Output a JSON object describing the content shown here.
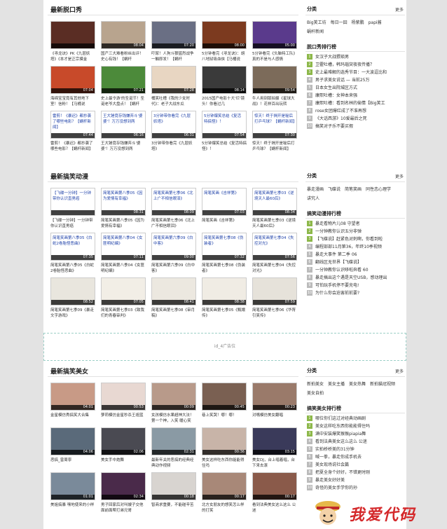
{
  "sections": [
    {
      "title": "最新脱口秀",
      "cards": [
        {
          "caption": "《寻龙诀》PK《九层妖塔》《本才是正宗摸金",
          "duration": "",
          "bg": "#5a2d24",
          "boxed": false
        },
        {
          "caption": "国产三大难看粉丝出评！史心有钱！【蜗杆",
          "duration": "08:04",
          "bg": "#b8a48e",
          "boxed": false
        },
        {
          "caption": "吓尿！人狗斗狠猛烈战争一触即发！【蜗杆",
          "duration": "07:20",
          "bg": "#6a6f84",
          "boxed": false
        },
        {
          "caption": "5分钟看完《寻龙诀》：胡八地狱吸血侠【马桶说",
          "duration": "08:00",
          "bg": "#7c3a1f",
          "boxed": false
        },
        {
          "caption": "5分钟看完《头脑特工队》真的不是与人感情",
          "duration": "05:00",
          "bg": "#5a3a8c",
          "boxed": false
        },
        {
          "caption": "海绵宝宝竟有其他地下室！信粉！【马桶说",
          "duration": "07:04",
          "bg": "#c84a2a",
          "boxed": false
        },
        {
          "caption": "史上最令游'的圣诞节！圣诞老爷大盘点！【蜗杆",
          "duration": "07:21",
          "bg": "#4c8a3a",
          "boxed": false
        },
        {
          "caption": "桶笑吐槽《我的少女时代》：老子大战东瓜",
          "duration": "07:28",
          "bg": "#e8d6c2",
          "boxed": false
        },
        {
          "caption": "2015国产电影十大'烂'镜头！你看过几",
          "duration": "08:14",
          "bg": "#3a3a3a",
          "boxed": false
        },
        {
          "caption": "牛人用刻版拍摄《星球大战》！花样百出玩转",
          "duration": "09:54",
          "bg": "#7c6b5a",
          "boxed": false
        },
        {
          "caption": "雷剪！《暴迟》都抄袭了哪些电影？【蜗杆新闻】",
          "duration": "07:44",
          "bg": "",
          "boxed": true
        },
        {
          "caption": "王大锤竟存钱嫌弃斗'婆婆'！万万没想到两",
          "duration": "06:16",
          "bg": "",
          "boxed": true
        },
        {
          "caption": "3分钟带你看完《九层妖塔》",
          "duration": "06:31",
          "bg": "",
          "boxed": true
        },
        {
          "caption": "5分钟爆笑总结《复活特搞怪》！",
          "duration": "07:54",
          "bg": "",
          "boxed": true
        },
        {
          "caption": "惊天！终于揭开是秘后打乒乓球？【蜗杆新闻】",
          "duration": "07:30",
          "bg": "",
          "boxed": true
        }
      ],
      "side_tags": [
        "Big笑工坊",
        "每日一囧",
        "杨紫鹏",
        "papi酱",
        "蜗杆新闻"
      ],
      "rank_title": "脱口秀排行榜",
      "rank": [
        "女汉子大战猥琐男",
        "卫霍吐槽，韩玛瑙突夜夜传播？",
        "史上最难解的选秀节目：一大波逗比和",
        "男子求美女说话 — 当前25万",
        "日本女生出院城区方式",
        "康熙吐槽：女神本来强",
        "康熙吐槽：看到名林的偷情【Big笑工",
        "rose女团爆红成了不准再想",
        "《大话西游》10爱最后之死",
        "搞笑对子乐不要买假"
      ]
    },
    {
      "title": "最新搞笑动漫",
      "cards": [
        {
          "caption": "【飞碟一分钟】一分钟带你认识直男癌",
          "duration": "",
          "bg": "",
          "boxed": true
        },
        {
          "caption": "简笔笑画第八季05《因为爱情有幸福》",
          "duration": "08:31",
          "bg": "",
          "boxed": true
        },
        {
          "caption": "简笔笑画第七季06《北上广不相信眼泪》",
          "duration": "08:09",
          "bg": "",
          "boxed": true
        },
        {
          "caption": "简笔笑画《吉祥第》",
          "duration": "07:03",
          "bg": "",
          "boxed": true
        },
        {
          "caption": "简笔笑画第七季03《逆境天人最60后》",
          "duration": "08:34",
          "bg": "",
          "boxed": true
        },
        {
          "caption": "简笔笑画第八季05《白蛇2卷胎怪恶曲》",
          "duration": "07:35",
          "bg": "",
          "boxed": true
        },
        {
          "caption": "简笔笑画第八季04《女匪明纪编》",
          "duration": "07:11",
          "bg": "",
          "boxed": true
        },
        {
          "caption": "简笔笑画第六季09《白中客》",
          "duration": "09:00",
          "bg": "",
          "boxed": true
        },
        {
          "caption": "简笔笑画第七季08《伪装者》",
          "duration": "07:32",
          "bg": "",
          "boxed": true
        },
        {
          "caption": "简笔笑画第七季04《失控对光》",
          "duration": "07:56",
          "bg": "",
          "boxed": true
        },
        {
          "caption": "简笔笑画第七季09《暴走文字游戏》",
          "duration": "08:52",
          "bg": "#e9e6de",
          "boxed": false
        },
        {
          "caption": "简笔笑画第七季03《致我们的青春审判》",
          "duration": "07:05",
          "bg": "#f2eee6",
          "boxed": false
        },
        {
          "caption": "简笔笑画第七季08《审月稿》",
          "duration": "08:41",
          "bg": "#ece8e0",
          "boxed": false
        },
        {
          "caption": "简笔笑画第七季05《甄嬛传》",
          "duration": "08:38",
          "bg": "#f0ece4",
          "boxed": false
        },
        {
          "caption": "简笔笑画第七季06《华胥引笑传》",
          "duration": "07:59",
          "bg": "#e6e2da",
          "boxed": false
        }
      ],
      "side_tags": [
        "暴走漫画",
        "飞碟说",
        "简笔笑画",
        "同性恋心理学",
        "讲究人"
      ],
      "rank_title": "搞笑动漫排行榜",
      "rank": [
        "暴走看物片儿08 守望者",
        "一分钟教你认识五分非弹",
        "【飞碟说】赶紧色对刺啊，你看到啦",
        "编程部部11月第36，年终10季视频",
        "暴走大事件 第二季 06",
        "翻线区无世界【飞碟说】",
        "一分钟教你认识哆啦奔看 60",
        "暴走搞出这个遇是天空USB，感动理出",
        "可怕玩手机停不要充电!",
        "为什么你会迫害前前要?"
      ]
    },
    {
      "title": "最新搞笑美女",
      "cards": [
        {
          "caption": "金星模仿秀搞笑大合集",
          "duration": "04:01",
          "bg": "#c89a86",
          "boxed": false
        },
        {
          "caption": "萝莉模仿金星秒杀王祖蓝",
          "duration": "00:53",
          "bg": "#e8d8d2",
          "boxed": false
        },
        {
          "caption": "女孩模仿水果超神大法！第一个神，入笑 暖心笑",
          "duration": "00:09",
          "bg": "#b89a8a",
          "boxed": false
        },
        {
          "caption": "巷上笑哭！哪！哪！",
          "duration": "00:45",
          "bg": "#7a6052",
          "boxed": false
        },
        {
          "caption": "对嘴模仿美女翻唱",
          "duration": "00:23",
          "bg": "#9a7a6a",
          "boxed": false
        },
        {
          "caption": "恶搞_曾周寧",
          "duration": "04:06",
          "bg": "#5a6a7a",
          "boxed": false
        },
        {
          "caption": "美女手中炮舞",
          "duration": "02:06",
          "bg": "#4a4a52",
          "boxed": false
        },
        {
          "caption": "最新年关的恶搞的经典经典动作视频",
          "duration": "02:31",
          "bg": "#8a9aa4",
          "boxed": false
        },
        {
          "caption": "美女这样吃东西你能能得住吗",
          "duration": "00:36",
          "bg": "#c8b4a8",
          "boxed": false
        },
        {
          "caption": "美女DJ，台上唱着唱，台下来去滚",
          "duration": "03:15",
          "bg": "#3a3a5a",
          "boxed": false
        },
        {
          "caption": "美姐搞暴 嘿地使来的小样",
          "duration": "01:01",
          "bg": "#7a8a9a",
          "boxed": false
        },
        {
          "caption": "男子回家后对叫嫂子交他面前面帮打弟兄哥",
          "duration": "02:34",
          "bg": "#4a2a4a",
          "boxed": false
        },
        {
          "caption": "智商求重要，不能碰辛苦",
          "duration": "00:18",
          "bg": "#d8d4d0",
          "boxed": false
        },
        {
          "caption": "北方女朋友的想笑怎么样的打笑",
          "duration": "00:17",
          "bg": "#a88878",
          "boxed": false
        },
        {
          "caption": "看到法典美女这么这么 公迷",
          "duration": "00:17",
          "bg": "#8a5a4a",
          "boxed": false
        }
      ],
      "side_tags": [
        "新拍美女",
        "美女主播",
        "美女热舞",
        "新拍猫冠视频",
        "美女自拍"
      ],
      "rank_title": "搞笑美女排行榜",
      "rank": [
        "哪位你们这过对经典动画剧",
        "美女这样吃东西你能能得住吗",
        "满中安装爆笑猴猴piapia舞",
        "看到法典美女这么这么 公迷",
        "实拍桥桥美的31分钟",
        "喊一拳，暴走你成手机去",
        "美女现场说社会篇",
        "把夏全身个好好，不错更时刚",
        "暴走美女好好美",
        "奇怪的美女手学你的孙"
      ]
    }
  ],
  "ad_text": "id_4广告位",
  "side_label": "分类",
  "more_label": "更多",
  "logo_text": "我爱代码"
}
